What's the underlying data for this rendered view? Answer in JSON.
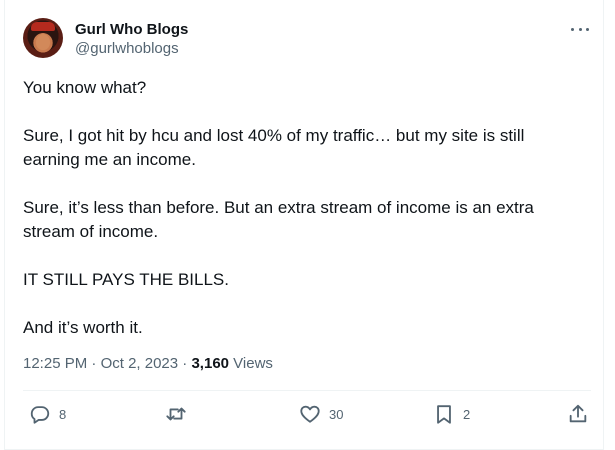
{
  "author": {
    "display_name": "Gurl Who Blogs",
    "handle": "@gurlwhoblogs"
  },
  "tweet": {
    "paragraphs": [
      "You know what?",
      "Sure, I got hit by hcu and lost 40% of my traffic… but my site is still earning me an income.",
      "Sure, it’s less than before. But an extra stream of income is an extra stream of income.",
      "IT STILL PAYS THE BILLS.",
      "And it’s worth it."
    ]
  },
  "meta": {
    "time": "12:25 PM",
    "separator": " · ",
    "date": "Oct 2, 2023",
    "views_count": "3,160",
    "views_label": " Views"
  },
  "actions": {
    "replies": "8",
    "retweets": "",
    "likes": "30",
    "bookmarks": "2"
  },
  "icons": {
    "avatar": "avatar-portrait",
    "more": "more-icon",
    "reply": "reply-icon",
    "retweet": "retweet-icon",
    "like": "heart-icon",
    "bookmark": "bookmark-icon",
    "share": "share-icon"
  },
  "colors": {
    "text": "#0f1419",
    "secondary": "#536471",
    "border": "#eff3f4"
  }
}
